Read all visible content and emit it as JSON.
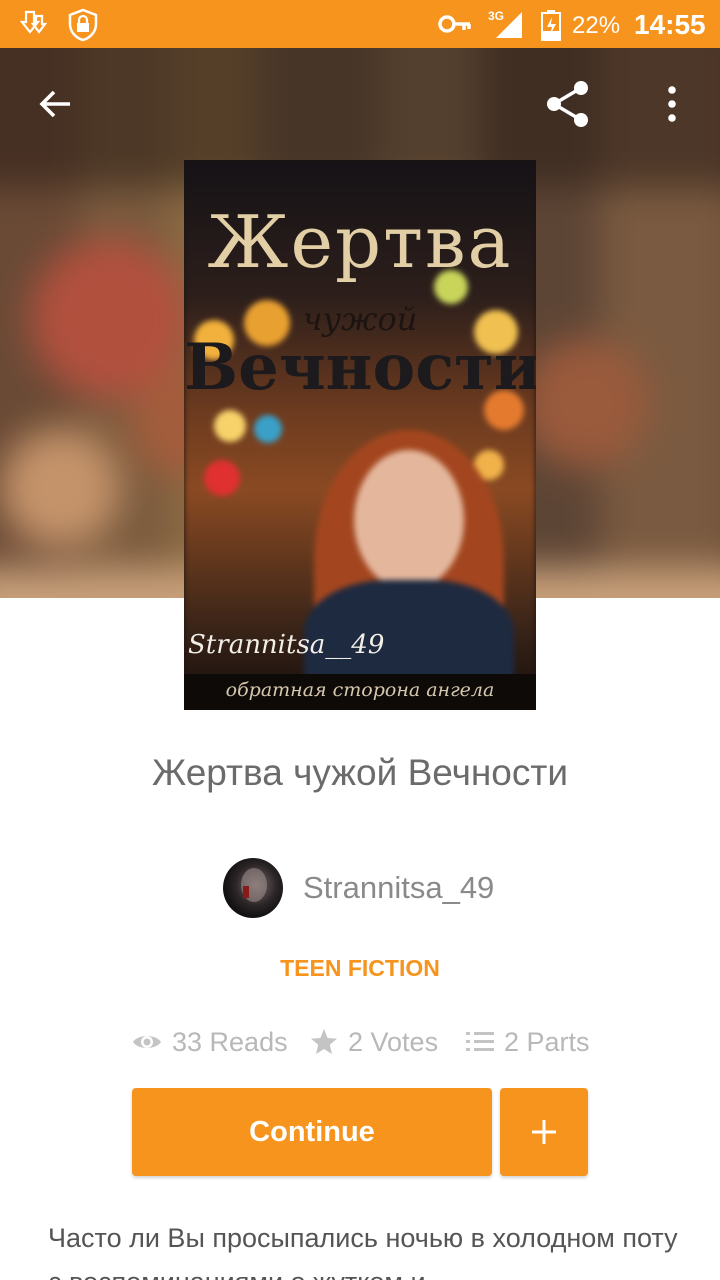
{
  "status_bar": {
    "battery": "22%",
    "time": "14:55",
    "network": "3G",
    "icons": [
      "download-icon",
      "vpn-lock-icon",
      "key-icon",
      "signal-icon",
      "battery-charging-icon"
    ]
  },
  "header": {
    "icons": [
      "back-arrow-icon",
      "share-icon",
      "more-vert-icon"
    ]
  },
  "cover": {
    "title_line1": "Жертва",
    "title_line2": "чужой",
    "title_line3": "Вечности",
    "author_signature": "Strannitsa__49",
    "tagline": "обратная сторона ангела"
  },
  "story": {
    "title": "Жертва чужой Вечности",
    "author": "Strannitsa_49",
    "category": "TEEN FICTION",
    "reads": "33 Reads",
    "votes": "2 Votes",
    "parts": "2 Parts",
    "description": "Часто ли Вы просыпались ночью в холодном поту с воспоминаниями о жутком и"
  },
  "actions": {
    "continue_label": "Continue",
    "add_label": "+"
  },
  "colors": {
    "accent": "#f7941d",
    "text_primary": "#6b6b6b",
    "text_muted": "#b8b8b8"
  }
}
